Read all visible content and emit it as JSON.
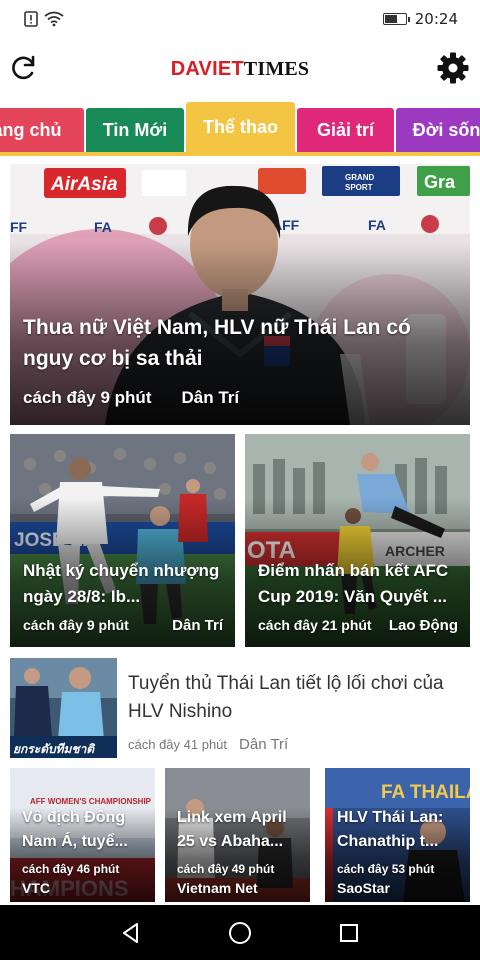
{
  "status_bar": {
    "time": "20:24",
    "battery_level": 0.55,
    "icons": [
      "alert-icon",
      "wifi-icon",
      "battery-icon"
    ]
  },
  "header": {
    "logo_part1": "DAVIET",
    "logo_part2": "TIMES",
    "refresh_icon": "refresh-icon",
    "settings_icon": "gear-icon"
  },
  "tabs": [
    {
      "label": "ang chủ",
      "color": "#e5455a"
    },
    {
      "label": "Tin Mới",
      "color": "#178a57"
    },
    {
      "label": "Thể thao",
      "color": "#f4c542",
      "active": true
    },
    {
      "label": "Giải trí",
      "color": "#e0287a"
    },
    {
      "label": "Đời sống",
      "color": "#9b39c0"
    }
  ],
  "featured": {
    "title": "Thua nữ Việt Nam, HLV nữ Thái Lan có nguy cơ bị sa thải",
    "time": "cách đây 9 phút",
    "source": "Dân Trí"
  },
  "articles": [
    {
      "title": "Nhật ký chuyển nhượng ngày 28/8: Ib...",
      "time": "cách đây 9 phút",
      "source": "Dân Trí"
    },
    {
      "title": "Điểm nhấn bán kết AFC Cup 2019: Văn Quyết ...",
      "time": "cách đây 21 phút",
      "source": "Lao Động"
    }
  ],
  "list_article": {
    "title": "Tuyển thủ Thái Lan tiết lộ lối chơi của HLV Nishino",
    "time": "cách đây 41 phút",
    "source": "Dân Trí"
  },
  "small_articles": [
    {
      "title": "Vô địch Đông Nam Á, tuyể...",
      "time": "cách đây 46 phút",
      "source": "VTC"
    },
    {
      "title": "Link xem April 25 vs Abaha...",
      "time": "cách đây 49 phút",
      "source": "Vietnam Net"
    },
    {
      "title": "HLV Thái Lan: Chanathip t...",
      "time": "cách đây 53 phút",
      "source": "SaoStar"
    }
  ],
  "image_texts": {
    "hero_sponsors": [
      "AirAsia",
      "GRAND SPORT",
      "FA",
      "AFF"
    ],
    "list_thumb_caption": "ยกระดับทีมชาติ",
    "small1_banner": "AFF WOMEN'S CHAMPIONSHIP",
    "small3_banner": "FA THAILA"
  },
  "nav_bar": {
    "icons": [
      "back-icon",
      "home-icon",
      "recents-icon"
    ]
  }
}
